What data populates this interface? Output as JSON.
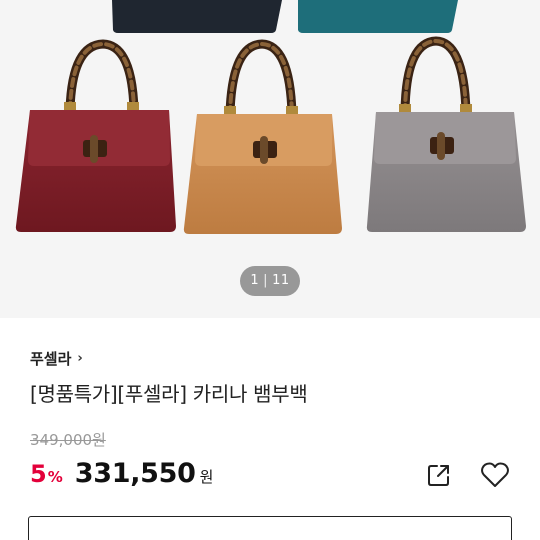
{
  "gallery": {
    "current_page": "1",
    "total_pages": "11"
  },
  "product": {
    "brand": "푸셀라",
    "brand_chevron": "›",
    "title": "[명품특가][푸셀라] 카리나 뱀부백",
    "original_price": "349,000원",
    "discount_value": "5",
    "discount_unit": "%",
    "price": "331,550",
    "price_unit": "원"
  },
  "icons": {
    "share": "share-icon",
    "favorite": "heart-icon"
  },
  "colors": {
    "discount": "#e3003a",
    "bag_burgundy": "#7e1e27",
    "bag_tan": "#c98a4e",
    "bag_grey": "#8c8789",
    "bag_navy": "#1f2630",
    "bag_teal": "#1e6e7a"
  }
}
